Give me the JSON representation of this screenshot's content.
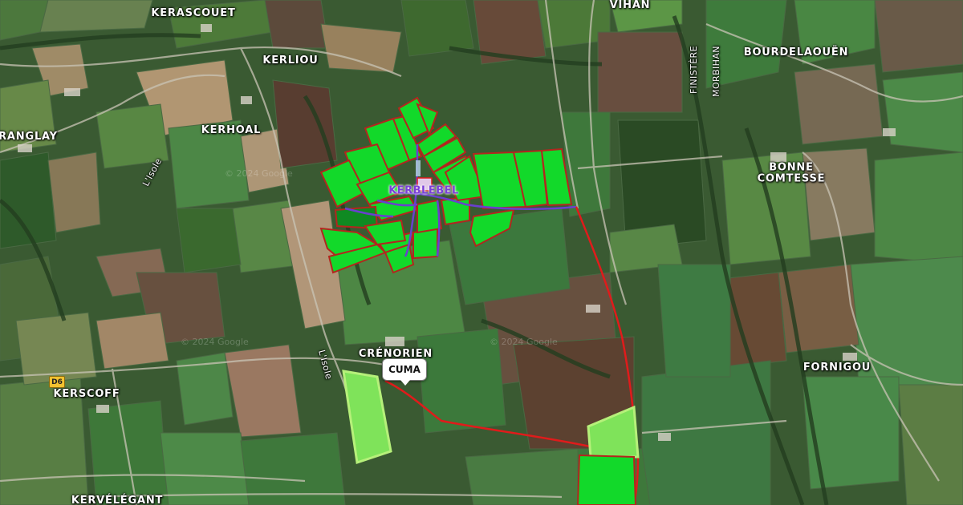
{
  "map": {
    "places": {
      "kerascouet": "KERASCOUET",
      "vihan": "VIHAN",
      "kerliou": "KERLIOU",
      "bourdelaouen": "BOURDELAOUËN",
      "ranglay": "RANGLAY",
      "kerhoal": "KERHOAL",
      "bonne_comtesse_1": "BONNE",
      "bonne_comtesse_2": "COMTESSE",
      "crenorien": "CRÉNORIEN",
      "fornigou": "FORNIGOU",
      "kerscoff": "KERSCOFF",
      "kervelegant": "KERVÉLÉGANT",
      "finistere": "FINISTÈRE",
      "morbihan": "MORBIHAN"
    },
    "rivers": {
      "isole_north": "L'Isole",
      "isole_south": "L'Isole"
    },
    "road_shield": "D6",
    "farm_label": "KERBLEBEL",
    "marker_label": "CUMA",
    "watermark": "© 2024 Google",
    "colors": {
      "parcel_fill": "#12d92a",
      "parcel_border": "#b3261e",
      "route": "#e01b1b",
      "farm_paths": "#6a3fcf",
      "highlight_fill": "#7fe35a",
      "highlight_border": "#b6f07a"
    }
  }
}
